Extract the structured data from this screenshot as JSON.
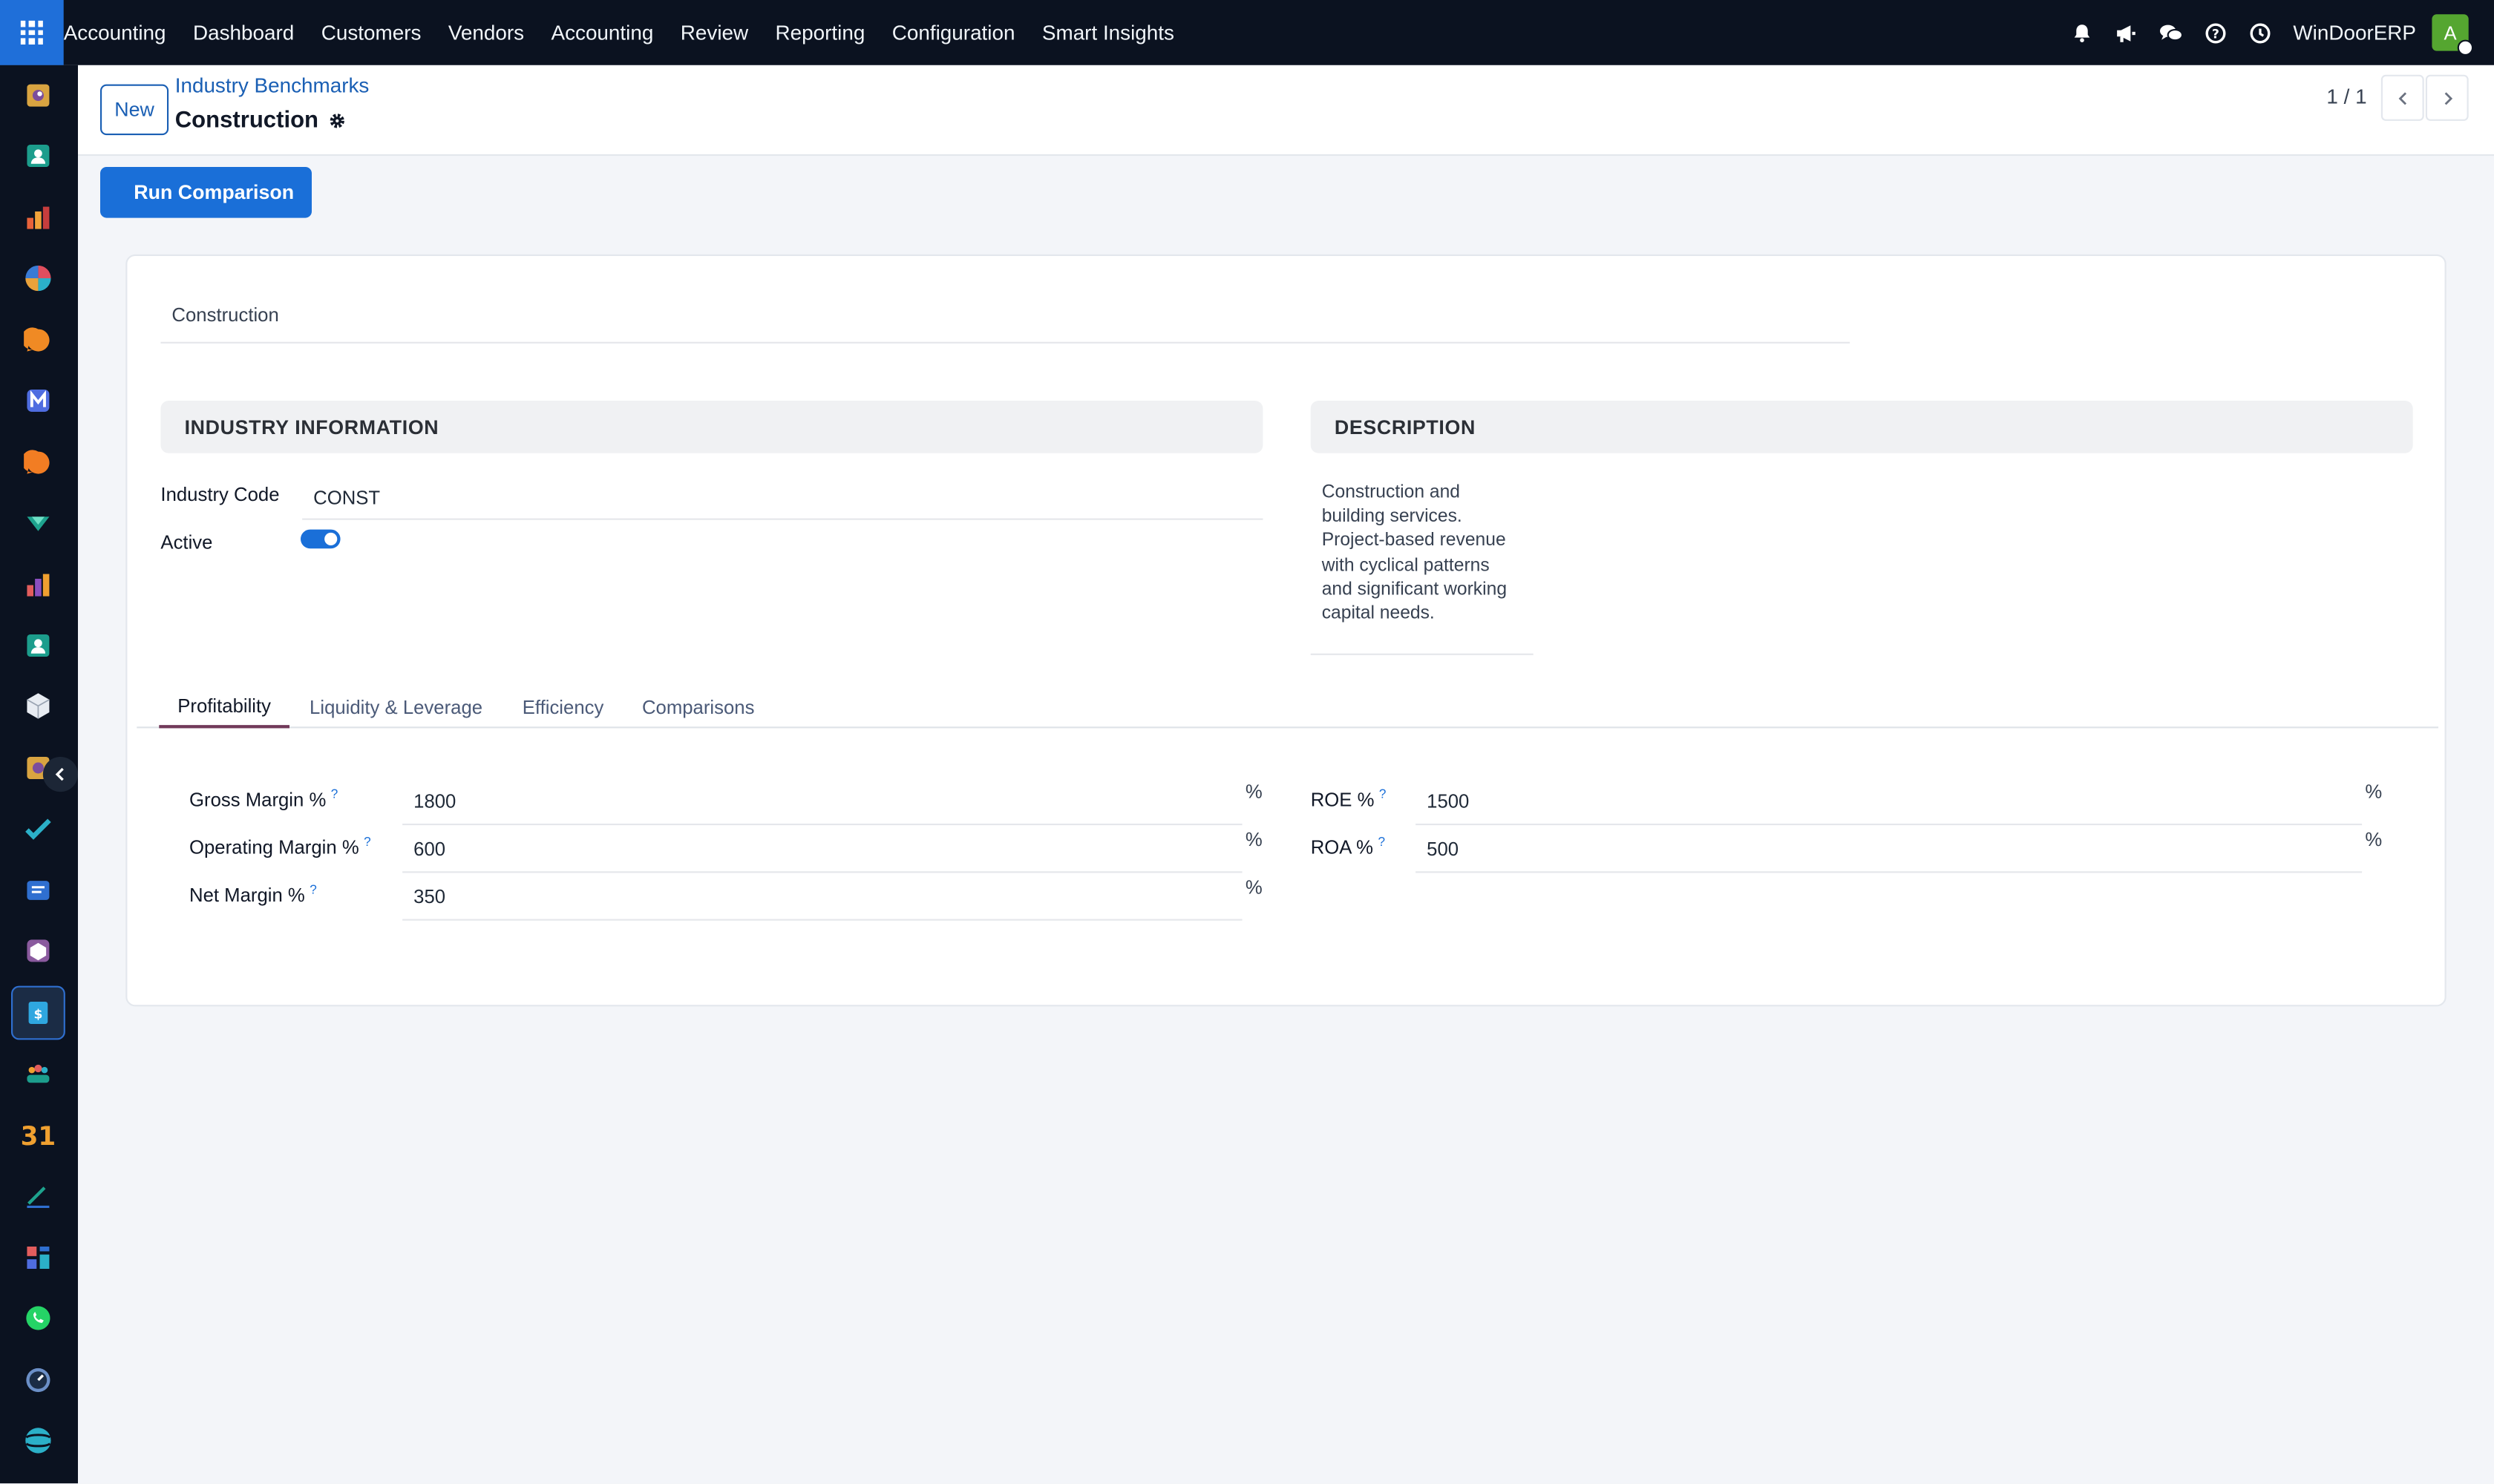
{
  "navbar": {
    "brand": "Accounting",
    "menu": [
      "Dashboard",
      "Customers",
      "Vendors",
      "Accounting",
      "Review",
      "Reporting",
      "Configuration",
      "Smart Insights"
    ],
    "company": "WinDoorERP",
    "avatar_letter": "A"
  },
  "sidebar": {
    "apps": [
      "reports-icon",
      "contacts-icon",
      "bar-chart-icon",
      "pie-chart-icon",
      "chat-icon",
      "mail-icon",
      "discuss-icon",
      "inventory-icon",
      "analytics-icon",
      "employees-icon",
      "package-icon",
      "sales-icon",
      "todo-icon",
      "knowledge-icon",
      "product-icon",
      "invoicing-icon",
      "team-icon",
      "calendar-icon",
      "sign-icon",
      "dashboards-icon",
      "whatsapp-icon",
      "time-icon",
      "website-icon"
    ],
    "active_app": "invoicing-icon"
  },
  "control": {
    "new_label": "New",
    "breadcrumb": "Industry Benchmarks",
    "title": "Construction",
    "pager": "1 / 1"
  },
  "actions": {
    "run_label": "Run Comparison"
  },
  "form": {
    "name": "Construction",
    "industry_info": {
      "header": "INDUSTRY INFORMATION",
      "code_label": "Industry Code",
      "code_value": "CONST",
      "active_label": "Active",
      "active": true
    },
    "description": {
      "header": "DESCRIPTION",
      "text": "Construction and building services. Project-based revenue with cyclical patterns and significant working capital needs."
    },
    "tabs": [
      "Profitability",
      "Liquidity & Leverage",
      "Efficiency",
      "Comparisons"
    ],
    "active_tab": "Profitability",
    "profitability": {
      "gross_margin_label": "Gross Margin %",
      "gross_margin_value": "1800",
      "operating_margin_label": "Operating Margin %",
      "operating_margin_value": "600",
      "net_margin_label": "Net Margin %",
      "net_margin_value": "350",
      "roe_label": "ROE %",
      "roe_value": "1500",
      "roa_label": "ROA %",
      "roa_value": "500",
      "percent_sign": "%",
      "help_mark": "?"
    }
  },
  "colors": {
    "navbar_bg": "#0b1220",
    "primary": "#1a6fd8",
    "link": "#1a5fb4",
    "active_tab": "#71395a"
  }
}
